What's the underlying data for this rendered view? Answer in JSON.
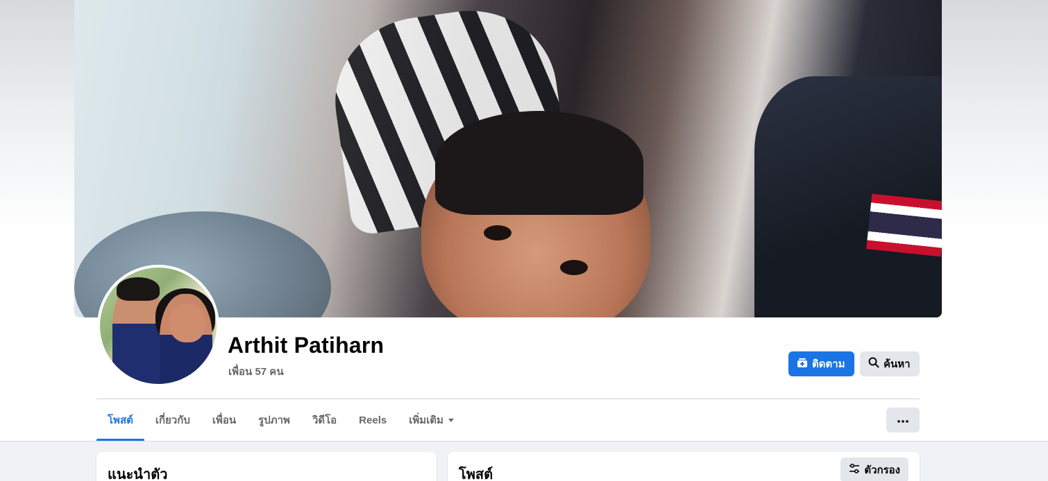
{
  "profile": {
    "name": "Arthit Patiharn",
    "friends_text": "เพื่อน 57 คน"
  },
  "actions": {
    "follow_label": "ติดตาม",
    "search_label": "ค้นหา"
  },
  "tabs": [
    {
      "label": "โพสต์",
      "active": true
    },
    {
      "label": "เกี่ยวกับ",
      "active": false
    },
    {
      "label": "เพื่อน",
      "active": false
    },
    {
      "label": "รูปภาพ",
      "active": false
    },
    {
      "label": "วิดีโอ",
      "active": false
    },
    {
      "label": "Reels",
      "active": false
    },
    {
      "label": "เพิ่มเติม",
      "active": false
    }
  ],
  "intro": {
    "title": "แนะนำตัว"
  },
  "posts": {
    "title": "โพสต์",
    "filter_label": "ตัวกรอง"
  },
  "icons": {
    "follow": "follow-icon",
    "search": "search-icon",
    "dropdown": "caret-down-icon",
    "more": "more-dots-icon",
    "filter": "filter-sliders-icon"
  },
  "colors": {
    "accent": "#1b74e4",
    "secondary_button": "#e4e6eb",
    "muted_text": "#65676b",
    "page_bg": "#f0f2f5"
  }
}
